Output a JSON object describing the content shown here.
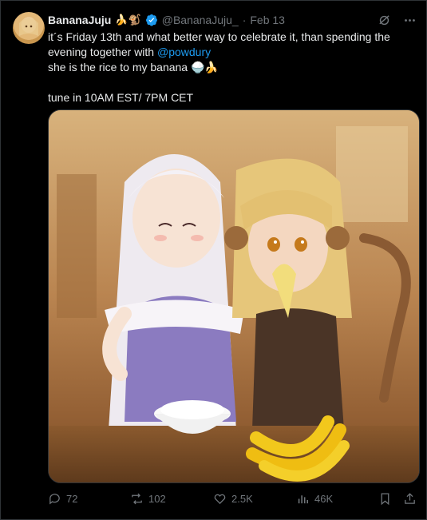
{
  "tweet": {
    "author_name": "BananaJuju",
    "author_emojis": "🍌🐒",
    "handle": "@BananaJuju_",
    "separator": "·",
    "date": "Feb 13",
    "text_line1": "it´s Friday 13th and what better way to celebrate it, than spending the evening together with ",
    "mention": "@powdury",
    "text_line2": "she is the rice to my banana 🍚🍌",
    "text_line3": "tune in 10AM EST/ 7PM CET"
  },
  "actions": {
    "replies": "72",
    "reposts": "102",
    "likes": "2.5K",
    "views": "46K"
  },
  "colors": {
    "background": "#000000",
    "text": "#e7e9ea",
    "muted": "#71767b",
    "accent": "#1d9bf0",
    "border": "#2f3336"
  },
  "icons": [
    "grok-icon",
    "more-icon",
    "verified-icon",
    "reply-icon",
    "repost-icon",
    "like-icon",
    "views-icon",
    "bookmark-icon",
    "share-icon"
  ]
}
